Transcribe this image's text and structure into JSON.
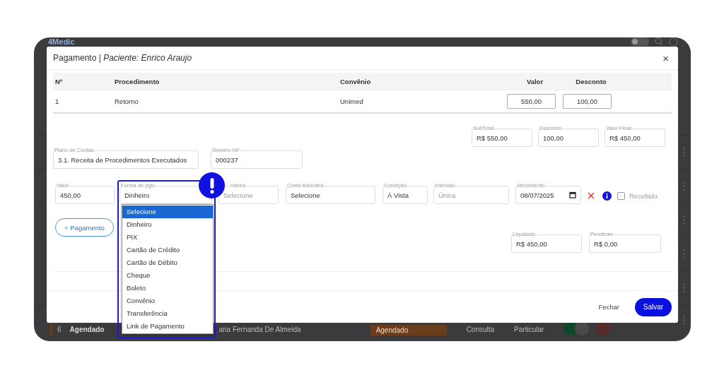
{
  "background_app": {
    "logo": "4Medic",
    "toggle": {
      "on": false
    },
    "row": {
      "number": "6",
      "status": "Agendado",
      "patient": "aria Fernanda De Almeida",
      "status_select": "Agendado",
      "type": "Consulta",
      "plan": "Particular"
    }
  },
  "modal": {
    "title": "Pagamento | *Paciente: Enrico Araujo*",
    "close": "×",
    "table": {
      "columns": [
        "Nº",
        "Procedimento",
        "Convênio",
        "Valor",
        "Desconto"
      ],
      "rows": [
        {
          "number": "1",
          "procedure": "Retorno",
          "insurance": "Unimed",
          "value": "550,00",
          "discount": "100,00"
        }
      ]
    },
    "totals": [
      {
        "label": "SubTotal",
        "value": "R$ 550,00"
      },
      {
        "label": "Desconto",
        "value": "100,00"
      },
      {
        "label": "Valor Final",
        "value": "R$ 450,00"
      }
    ],
    "account_fields": [
      {
        "label": "Plano de Contas",
        "value": "3.1. Receita de Procedimentos Executados"
      },
      {
        "label": "Número NF",
        "value": "000237"
      }
    ],
    "payment": {
      "value": {
        "label": "Valor",
        "value": "450,00"
      },
      "method": {
        "label": "Forma de pgto",
        "value": "Dinheiro",
        "expanded": true,
        "options": [
          {
            "label": "Selecione",
            "highlighted": true
          },
          {
            "label": "Dinheiro",
            "highlighted": false
          },
          {
            "label": "PIX",
            "highlighted": false
          },
          {
            "label": "Cartão de Crédito",
            "highlighted": false
          },
          {
            "label": "Cartão de Débito",
            "highlighted": false
          },
          {
            "label": "Cheque",
            "highlighted": false
          },
          {
            "label": "Boleto",
            "highlighted": false
          },
          {
            "label": "Convênio",
            "highlighted": false
          },
          {
            "label": "Transferência",
            "highlighted": false
          },
          {
            "label": "Link de Pagamento",
            "highlighted": false
          }
        ]
      },
      "fields": [
        {
          "label": "ndeira",
          "placeholder": "Selecione"
        },
        {
          "label": "Conta Bancária",
          "value": "Selecione"
        },
        {
          "label": "Condição",
          "value": "À Vista"
        },
        {
          "label": "Intervalo",
          "placeholder": "Única"
        },
        {
          "label": "Vencimento",
          "value": "08/07/2025",
          "kind": "date"
        }
      ],
      "received": {
        "label": "Recebido",
        "checked": false
      }
    },
    "add_payment": "+ Pagamento",
    "balances": [
      {
        "label": "Liquidado",
        "value": "R$ 450,00"
      },
      {
        "label": "Pendente",
        "value": "R$ 0,00"
      }
    ],
    "buttons": {
      "close": "Fechar",
      "save": "Salvar"
    }
  }
}
